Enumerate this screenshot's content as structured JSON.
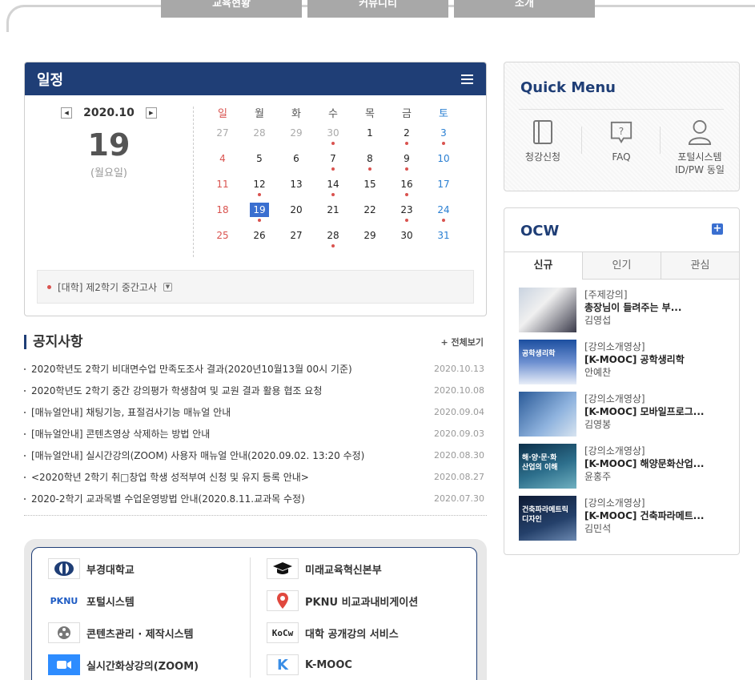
{
  "top_tabs": [
    "교육현황",
    "커뮤니티",
    "소개"
  ],
  "schedule": {
    "title": "일정",
    "month": "2020.10",
    "day": "19",
    "weekday": "(월요일)",
    "weekdays": [
      "일",
      "월",
      "화",
      "수",
      "목",
      "금",
      "토"
    ],
    "weeks": [
      [
        {
          "d": "27",
          "muted": true
        },
        {
          "d": "28",
          "muted": true
        },
        {
          "d": "29",
          "muted": true
        },
        {
          "d": "30",
          "muted": true,
          "dot": true
        },
        {
          "d": "1"
        },
        {
          "d": "2",
          "dot": true
        },
        {
          "d": "3",
          "dot": true
        }
      ],
      [
        {
          "d": "4"
        },
        {
          "d": "5"
        },
        {
          "d": "6"
        },
        {
          "d": "7",
          "dot": true
        },
        {
          "d": "8",
          "dot": true
        },
        {
          "d": "9",
          "dot": true
        },
        {
          "d": "10"
        }
      ],
      [
        {
          "d": "11"
        },
        {
          "d": "12",
          "dot": true
        },
        {
          "d": "13"
        },
        {
          "d": "14",
          "dot": true
        },
        {
          "d": "15"
        },
        {
          "d": "16",
          "dot": true
        },
        {
          "d": "17"
        }
      ],
      [
        {
          "d": "18"
        },
        {
          "d": "19",
          "today": true,
          "dot": true
        },
        {
          "d": "20"
        },
        {
          "d": "21"
        },
        {
          "d": "22"
        },
        {
          "d": "23",
          "dot": true
        },
        {
          "d": "24",
          "dot": true
        }
      ],
      [
        {
          "d": "25"
        },
        {
          "d": "26"
        },
        {
          "d": "27"
        },
        {
          "d": "28",
          "dot": true
        },
        {
          "d": "29"
        },
        {
          "d": "30"
        },
        {
          "d": "31"
        }
      ]
    ],
    "event": "[대학] 제2학기 중간고사"
  },
  "notice": {
    "title": "공지사항",
    "more": "+ 전체보기",
    "items": [
      {
        "title": "2020학년도 2학기 비대면수업 만족도조사 결과(2020년10월13월 00시 기준)",
        "date": "2020.10.13"
      },
      {
        "title": "2020학년도 2학기 중간 강의평가 학생참여 및 교원 결과 활용 협조 요청",
        "date": "2020.10.08"
      },
      {
        "title": "[매뉴얼안내] 채팅기능, 표절검사기능 매뉴얼 안내",
        "date": "2020.09.04"
      },
      {
        "title": "[매뉴얼안내] 콘텐츠영상 삭제하는 방법 안내",
        "date": "2020.09.03"
      },
      {
        "title": "[매뉴얼안내] 실시간강의(ZOOM) 사용자 매뉴얼 안내(2020.09.02. 13:20 수정)",
        "date": "2020.08.30"
      },
      {
        "title": "<2020학년 2학기 취□창업 학생 성적부여 신청 및 유지 등록 안내>",
        "date": "2020.08.27"
      },
      {
        "title": "2020-2학기 교과목별 수업운영방법 안내(2020.8.11.교과목 수정)",
        "date": "2020.07.30"
      }
    ]
  },
  "links": {
    "left": [
      "부경대학교",
      "포털시스템",
      "콘텐츠관리 · 제작시스템",
      "실시간화상강의(ZOOM)"
    ],
    "right": [
      "미래교육혁신본부",
      "PKNU 비교과내비게이션",
      "대학 공개강의 서비스",
      "K-MOOC"
    ],
    "pknu_logo": "PKNU",
    "kocw_logo": "KoCw",
    "kmooc_logo": "K"
  },
  "quick_menu": {
    "title": "Quick Menu",
    "items": [
      "청강신청",
      "FAQ",
      "포털시스템",
      "ID/PW 동일"
    ]
  },
  "ocw": {
    "title": "OCW",
    "plus": "+",
    "tabs": [
      "신규",
      "인기",
      "관심"
    ],
    "items": [
      {
        "cat": "[주제강의]",
        "title": "총장님이 들려주는 부...",
        "author": "김영섭"
      },
      {
        "cat": "[강의소개영상]",
        "title": "[K-MOOC] 공학생리학",
        "author": "안예찬"
      },
      {
        "cat": "[강의소개영상]",
        "title": "[K-MOOC] 모바일프로그...",
        "author": "김영봉"
      },
      {
        "cat": "[강의소개영상]",
        "title": "[K-MOOC] 해양문화산업...",
        "author": "윤홍주"
      },
      {
        "cat": "[강의소개영상]",
        "title": "[K-MOOC] 건축파라메트...",
        "author": "김민석"
      }
    ],
    "thumb_text": [
      "",
      "공학생리학",
      "",
      "해·양·문·화\n산업의 이해",
      "건축파라메트릭\n디자인"
    ]
  },
  "colors": {
    "primary": "#1f3e76",
    "accent": "#3a6fd0",
    "dot": "#d9534f"
  }
}
